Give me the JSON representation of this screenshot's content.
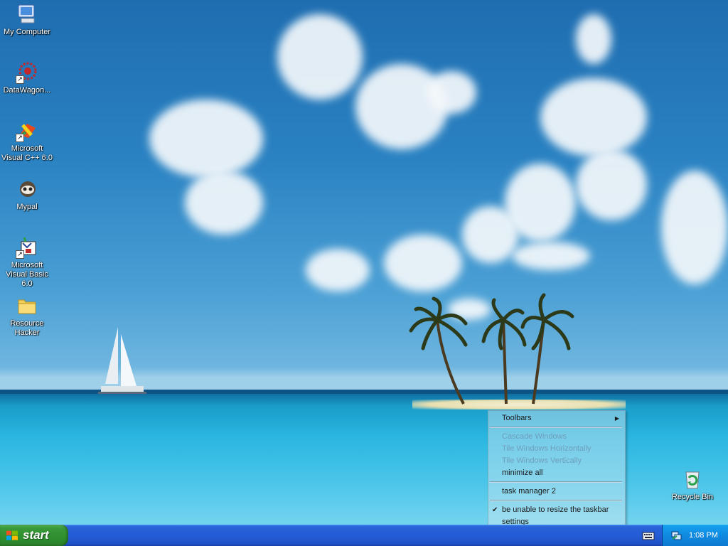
{
  "desktop": {
    "icons": [
      {
        "label": "My Computer",
        "icon": "my-computer-icon"
      },
      {
        "label": "DataWagon...",
        "icon": "datawagon-icon"
      },
      {
        "label": "Microsoft Visual C++ 6.0",
        "icon": "visual-cpp-icon"
      },
      {
        "label": "Mypal",
        "icon": "mypal-icon"
      },
      {
        "label": "Microsoft Visual Basic 6.0",
        "icon": "visual-basic-icon"
      },
      {
        "label": "Resource Hacker",
        "icon": "folder-icon"
      },
      {
        "label": "Recycle Bin",
        "icon": "recycle-bin-icon"
      }
    ]
  },
  "context_menu": {
    "items": [
      {
        "label": "Toolbars",
        "enabled": true,
        "submenu": true
      },
      {
        "label": "Cascade Windows",
        "enabled": false
      },
      {
        "label": "Tile Windows Horizontally",
        "enabled": false
      },
      {
        "label": "Tile Windows Vertically",
        "enabled": false
      },
      {
        "label": "minimize all",
        "enabled": true
      },
      {
        "label": "task manager 2",
        "enabled": true
      },
      {
        "label": "be unable to resize the taskbar",
        "enabled": true,
        "checked": true
      },
      {
        "label": "settings",
        "enabled": true
      }
    ]
  },
  "taskbar": {
    "start_label": "start",
    "clock": "1:08 PM",
    "tray_icons": [
      "keyboard-icon",
      "network-icon"
    ]
  },
  "colors": {
    "taskbar_blue": "#245cd8",
    "start_green": "#3a9a3a",
    "tray_blue": "#0f8ae0"
  }
}
